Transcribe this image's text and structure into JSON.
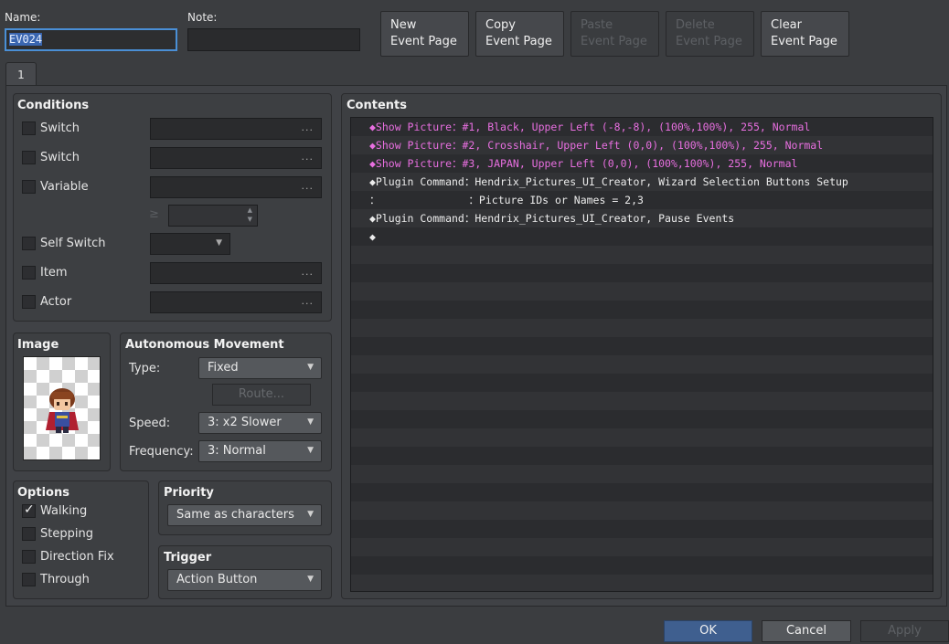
{
  "header": {
    "name_label": "Name:",
    "name_value": "EV024",
    "note_label": "Note:",
    "note_value": ""
  },
  "page_buttons": {
    "new": [
      "New",
      "Event Page"
    ],
    "copy": [
      "Copy",
      "Event Page"
    ],
    "paste": [
      "Paste",
      "Event Page"
    ],
    "delete": [
      "Delete",
      "Event Page"
    ],
    "clear": [
      "Clear",
      "Event Page"
    ]
  },
  "tabs": [
    {
      "label": "1"
    }
  ],
  "conditions": {
    "title": "Conditions",
    "switch1_label": "Switch",
    "switch2_label": "Switch",
    "variable_label": "Variable",
    "ge_symbol": "≥",
    "self_switch_label": "Self Switch",
    "item_label": "Item",
    "actor_label": "Actor",
    "dots": "..."
  },
  "image": {
    "title": "Image",
    "sprite": "hero-character-sprite"
  },
  "autonomous": {
    "title": "Autonomous Movement",
    "type_label": "Type:",
    "type_value": "Fixed",
    "route_label": "Route...",
    "speed_label": "Speed:",
    "speed_value": "3: x2 Slower",
    "frequency_label": "Frequency:",
    "frequency_value": "3: Normal"
  },
  "options": {
    "title": "Options",
    "walking": "Walking",
    "walking_checked": true,
    "stepping": "Stepping",
    "direction_fix": "Direction Fix",
    "through": "Through"
  },
  "priority": {
    "title": "Priority",
    "value": "Same as characters"
  },
  "trigger": {
    "title": "Trigger",
    "value": "Action Button"
  },
  "contents": {
    "title": "Contents",
    "lines": [
      {
        "text": "◆Show Picture：#1, Black, Upper Left (-8,-8), (100%,100%), 255, Normal",
        "style": "pink"
      },
      {
        "text": "◆Show Picture：#2, Crosshair, Upper Left (0,0), (100%,100%), 255, Normal",
        "style": "pink"
      },
      {
        "text": "◆Show Picture：#3, JAPAN, Upper Left (0,0), (100%,100%), 255, Normal",
        "style": "pink"
      },
      {
        "text": "◆Plugin Command：Hendrix_Pictures_UI_Creator, Wizard Selection Buttons Setup",
        "style": "white"
      },
      {
        "text": "：              ：Picture IDs or Names = 2,3",
        "style": "white"
      },
      {
        "text": "◆Plugin Command：Hendrix_Pictures_UI_Creator, Pause Events",
        "style": "white"
      },
      {
        "text": "◆",
        "style": "white"
      }
    ]
  },
  "footer": {
    "ok": "OK",
    "cancel": "Cancel",
    "apply": "Apply"
  },
  "colors": {
    "background": "#3b3d40",
    "pink_command": "#e86fe0",
    "ok_button": "#3f5f8f",
    "name_focus": "#4a8fd6"
  }
}
